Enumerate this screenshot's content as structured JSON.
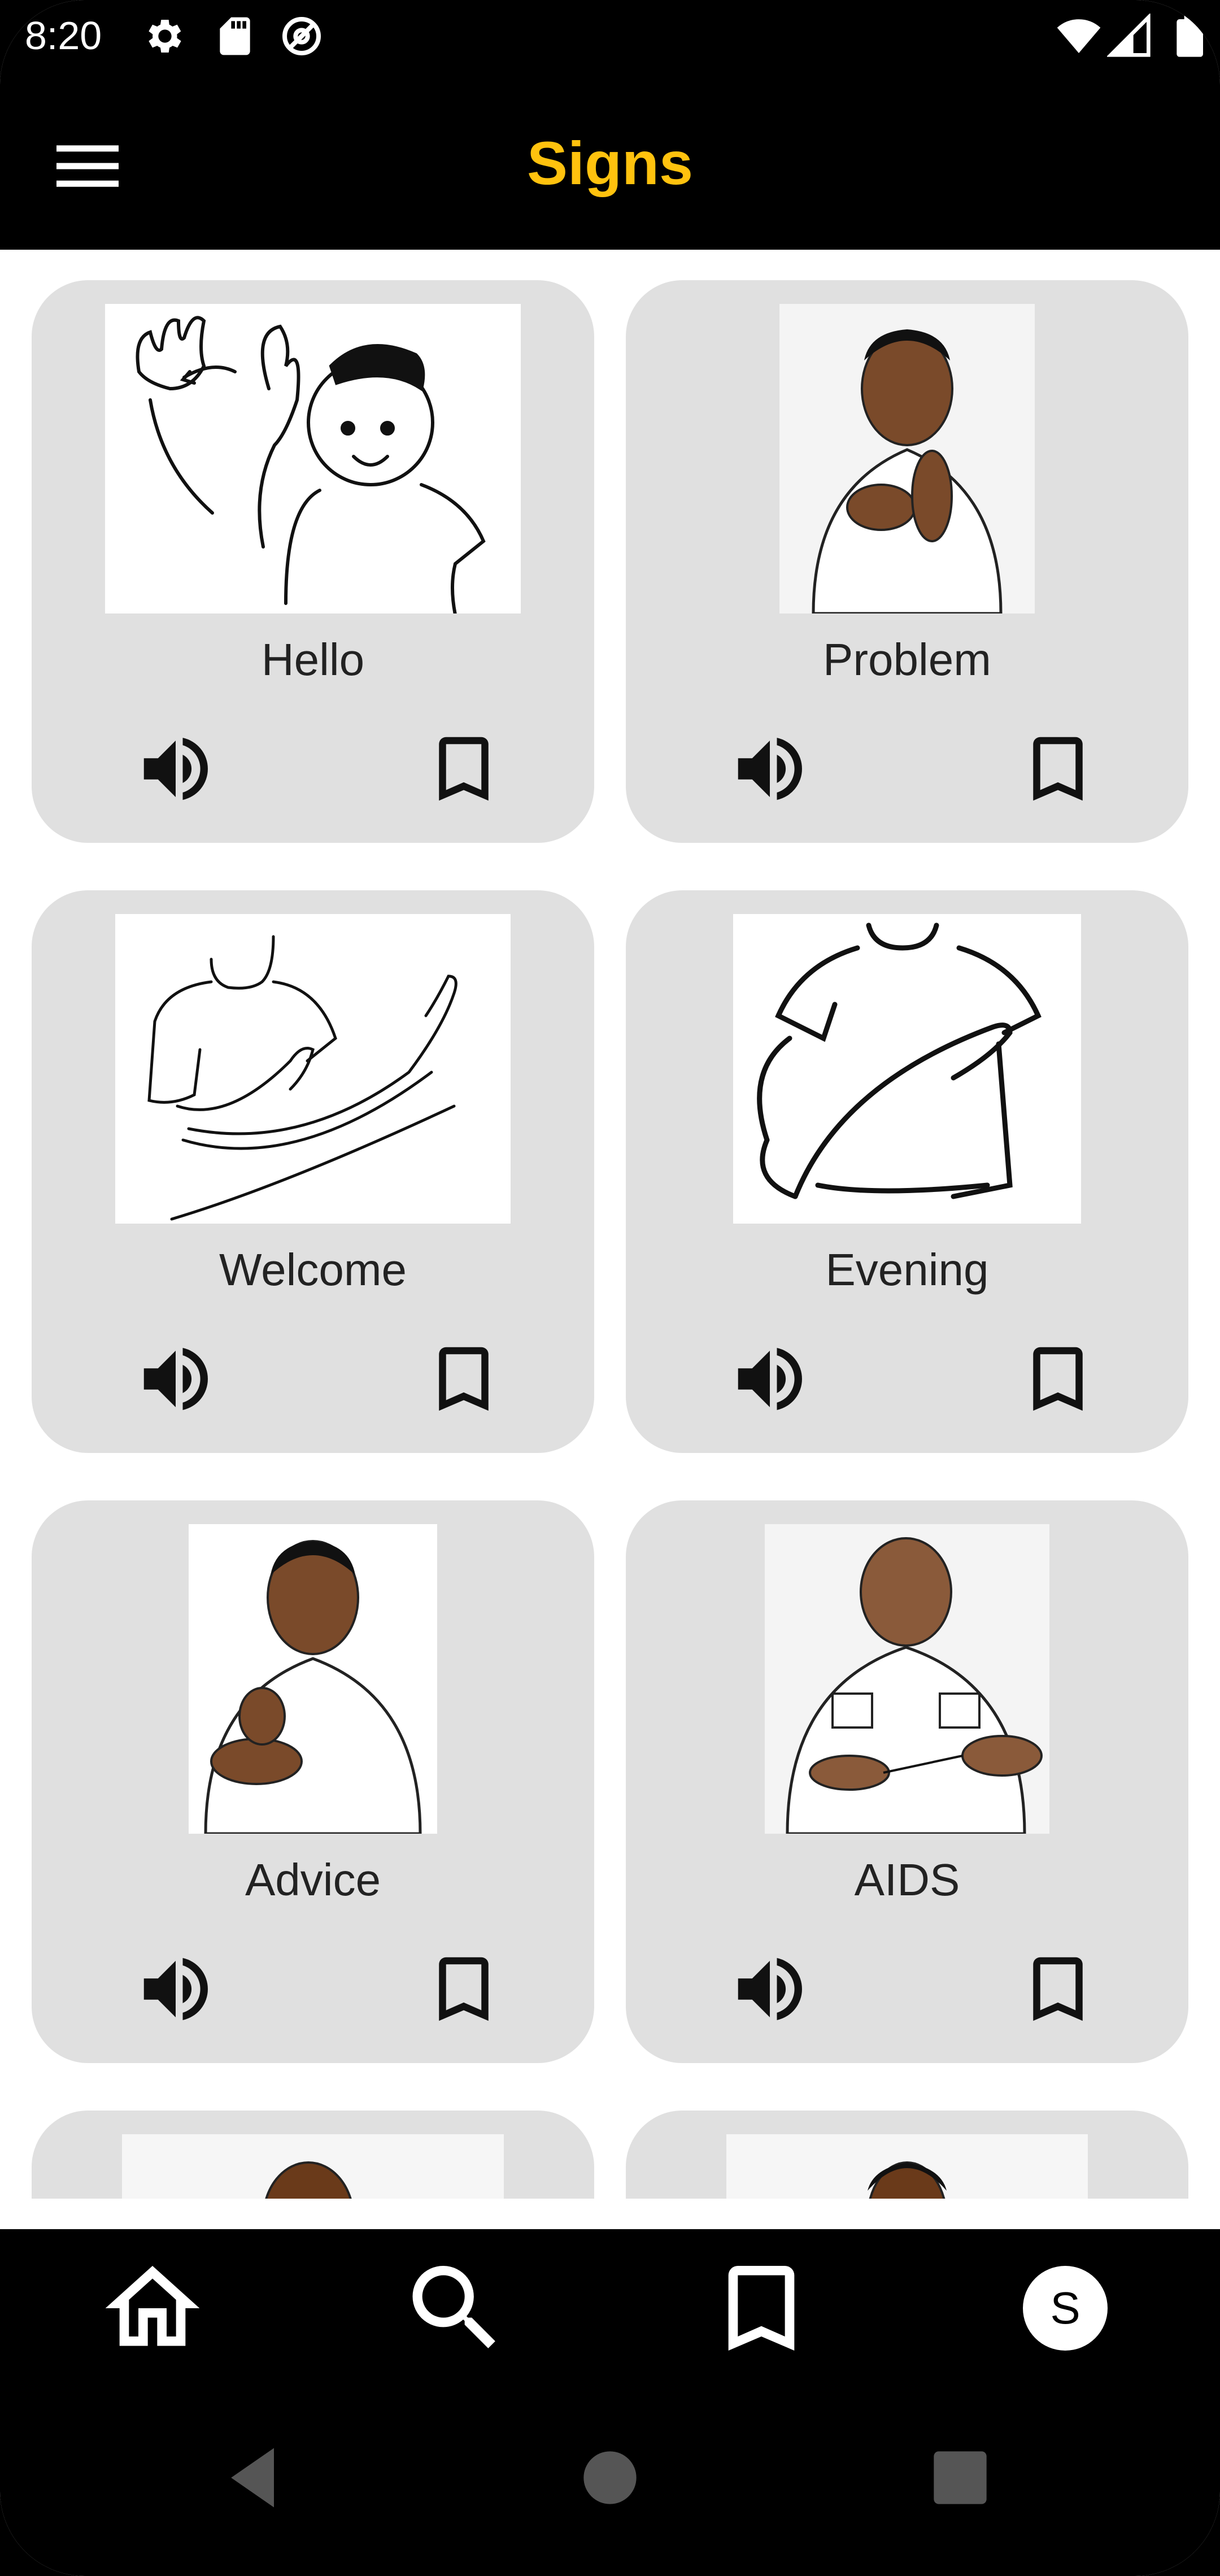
{
  "status_bar": {
    "time": "8:20",
    "left_icons": [
      "settings-icon",
      "sd-card-icon",
      "at-sign-icon"
    ],
    "right_icons": [
      "wifi-icon",
      "cellular-signal-icon",
      "battery-icon"
    ]
  },
  "app_bar": {
    "title": "Signs",
    "title_color": "#FFC20E",
    "menu_icon": "hamburger-menu-icon"
  },
  "signs": [
    {
      "label": "Hello"
    },
    {
      "label": "Problem"
    },
    {
      "label": "Welcome"
    },
    {
      "label": "Evening"
    },
    {
      "label": "Advice"
    },
    {
      "label": "AIDS"
    }
  ],
  "card_actions": {
    "sound_icon": "speaker-icon",
    "bookmark_icon": "bookmark-icon"
  },
  "bottom_nav": {
    "items": [
      {
        "icon": "home-icon"
      },
      {
        "icon": "search-icon"
      },
      {
        "icon": "bookmark-icon"
      },
      {
        "icon": "profile-avatar",
        "avatar_letter": "S"
      }
    ]
  },
  "system_nav": [
    "back-icon",
    "home-circle-icon",
    "recents-icon"
  ]
}
